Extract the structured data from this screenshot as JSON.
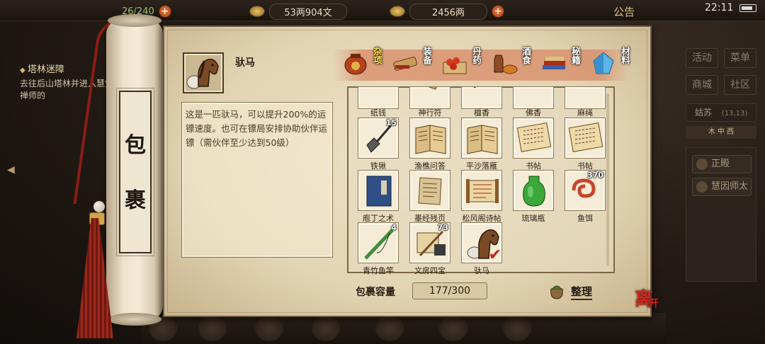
{
  "topbar": {
    "capacity_text": "26/240",
    "money_text": "53两904文",
    "gold_text": "2456两",
    "notice_label": "公告",
    "clock": "22:11"
  },
  "quest": {
    "title": "塔林迷障",
    "desc": "去往后山塔林并进入慧觉禅师的"
  },
  "right_panel": {
    "buttons": [
      "活动",
      "菜单",
      "商城",
      "社区"
    ],
    "location": "姑苏",
    "coords": "(13,13)",
    "compass": "木  中  西",
    "npcs": [
      "正殿",
      "慧因师太"
    ]
  },
  "bag": {
    "title_chars": [
      "包",
      "裹"
    ],
    "selected": {
      "name": "驮马",
      "description": "这是一匹驮马，可以提升200%的运镖速度。也可在镖局安排协助伙伴运镖（需伙伴至少达到50级）"
    },
    "tabs": [
      {
        "label": "杂项",
        "icon": "jar-icon",
        "active": true
      },
      {
        "label": "装备",
        "icon": "sword-icon",
        "active": false
      },
      {
        "label": "丹药",
        "icon": "pills-icon",
        "active": false
      },
      {
        "label": "酒食",
        "icon": "wine-food-icon",
        "active": false
      },
      {
        "label": "秘籍",
        "icon": "books-icon",
        "active": false
      },
      {
        "label": "材料",
        "icon": "crystal-icon",
        "active": false
      }
    ],
    "items": [
      {
        "name": "纸钱",
        "qty": "",
        "icon": "paper-money-icon"
      },
      {
        "name": "神行符",
        "qty": "",
        "icon": "talisman-icon"
      },
      {
        "name": "檀香",
        "qty": "",
        "icon": "incense-icon"
      },
      {
        "name": "佛香",
        "qty": "",
        "icon": "incense-sticks-icon"
      },
      {
        "name": "麻绳",
        "qty": "",
        "icon": "rope-icon"
      },
      {
        "name": "铁锹",
        "qty": "15",
        "icon": "shovel-icon"
      },
      {
        "name": "渔樵问答",
        "qty": "",
        "icon": "open-book-icon"
      },
      {
        "name": "平沙落雁",
        "qty": "",
        "icon": "open-book-icon"
      },
      {
        "name": "书帖",
        "qty": "",
        "icon": "calligraphy-icon"
      },
      {
        "name": "书帖",
        "qty": "",
        "icon": "calligraphy-icon"
      },
      {
        "name": "庖丁之术",
        "qty": "",
        "icon": "blue-book-icon"
      },
      {
        "name": "墨经残页",
        "qty": "",
        "icon": "scroll-page-icon"
      },
      {
        "name": "松风阁诗帖",
        "qty": "",
        "icon": "scroll-icon"
      },
      {
        "name": "琉璃瓶",
        "qty": "",
        "icon": "green-bottle-icon"
      },
      {
        "name": "鱼饵",
        "qty": "370",
        "icon": "worm-icon"
      },
      {
        "name": "青竹鱼竿",
        "qty": "4",
        "icon": "fishing-rod-icon"
      },
      {
        "name": "文房四宝",
        "qty": "73",
        "icon": "stationery-icon"
      },
      {
        "name": "驮马",
        "qty": "",
        "icon": "horse-icon",
        "checked": true
      }
    ],
    "capacity_label": "包裹容量",
    "capacity_value": "177/300",
    "sort_label": "整理",
    "close_label_main": "离",
    "close_label_sub": "开"
  },
  "colors": {
    "tab_strip": "#d7845f",
    "active_tab_text": "#ffe24a",
    "close_red": "#d6251c"
  }
}
